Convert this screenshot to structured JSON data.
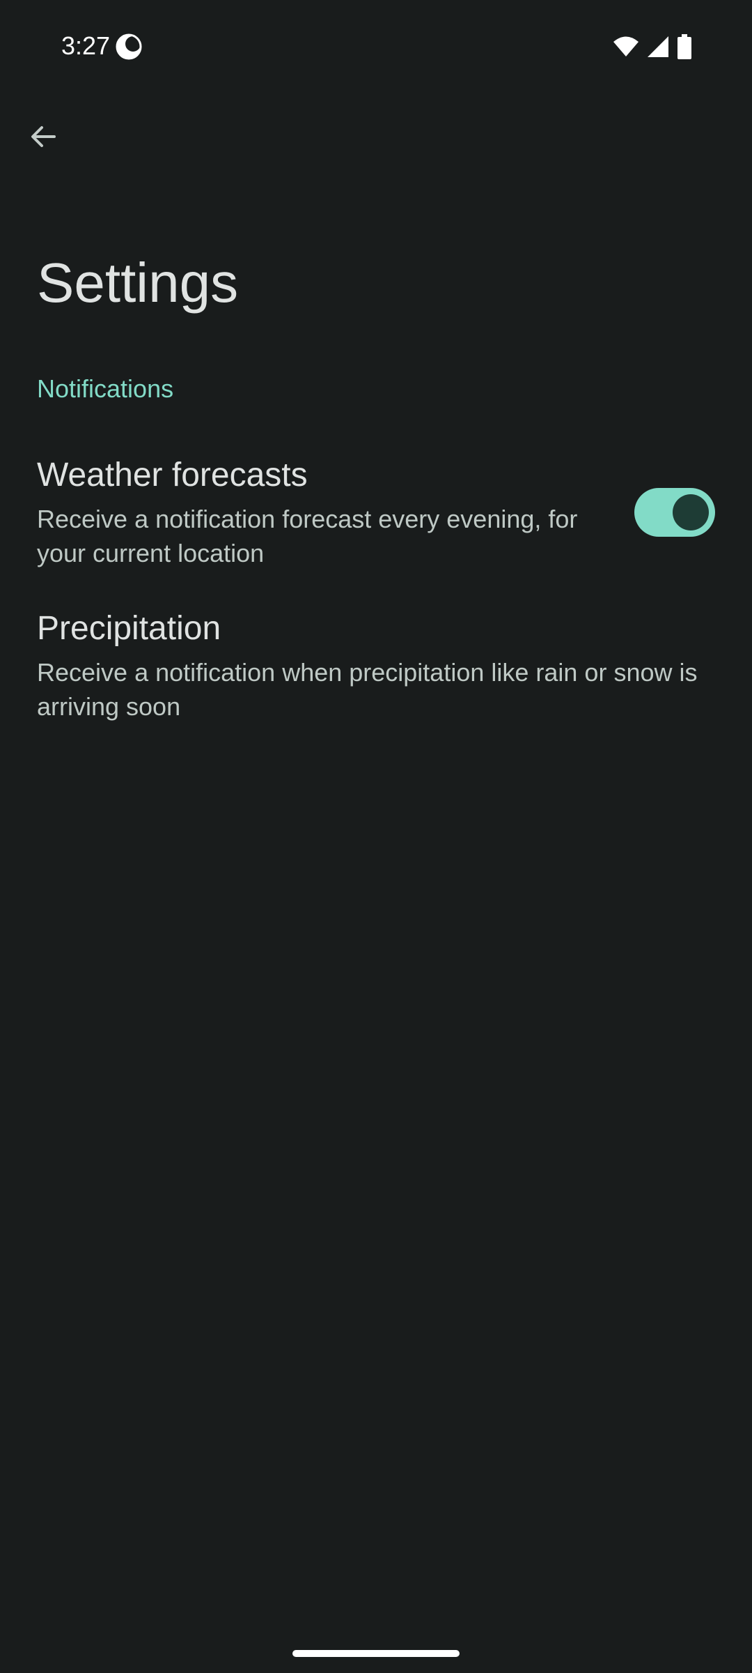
{
  "status_bar": {
    "time": "3:27",
    "icons": [
      "do-not-disturb-icon",
      "wifi-icon",
      "cell-signal-icon",
      "battery-icon"
    ]
  },
  "header": {
    "back_icon": "arrow-back-icon",
    "title": "Settings"
  },
  "sections": [
    {
      "header": "Notifications",
      "items": [
        {
          "title": "Weather forecasts",
          "summary": "Receive a notification forecast every evening, for your current location",
          "toggle_on": true
        },
        {
          "title": "Precipitation",
          "summary": "Receive a notification when precipitation like rain or snow is arriving soon"
        }
      ]
    }
  ],
  "colors": {
    "background": "#191c1c",
    "accent": "#82dbc7",
    "toggle_thumb": "#1e3c35",
    "primary_text": "#e0e3e2",
    "secondary_text": "#bfc9c5"
  }
}
